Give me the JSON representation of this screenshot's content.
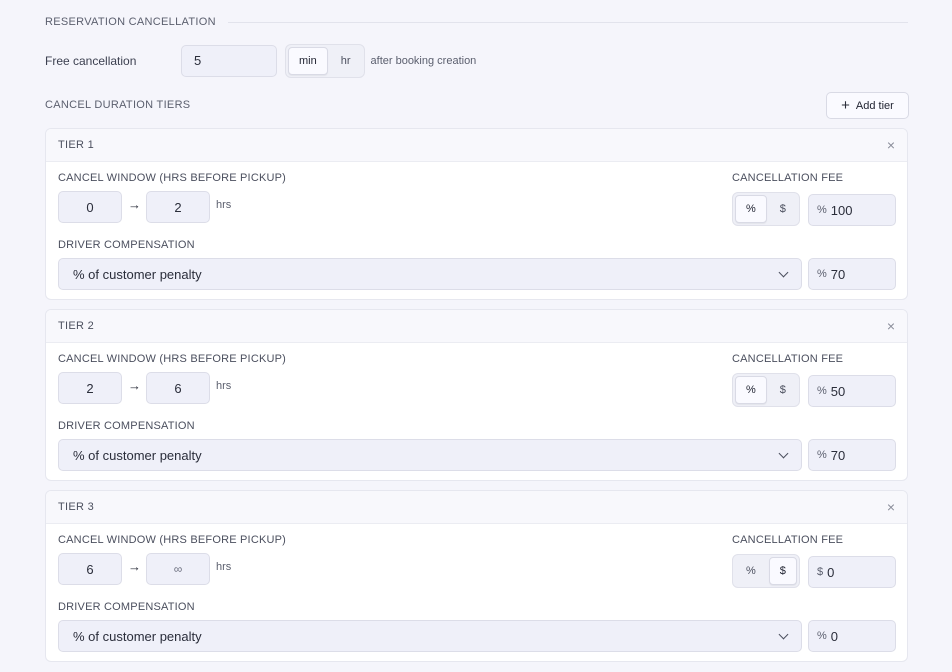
{
  "section": {
    "title": "RESERVATION CANCELLATION"
  },
  "free_cancellation": {
    "label": "Free cancellation",
    "value": "5",
    "units": [
      "min",
      "hr"
    ],
    "selected_unit": "min",
    "suffix": "after booking creation"
  },
  "tiers_section": {
    "title": "CANCEL DURATION TIERS",
    "add_label": "Add tier",
    "add_icon": "plus-icon"
  },
  "labels": {
    "window": "CANCEL WINDOW (HRS BEFORE PICKUP)",
    "fee": "CANCELLATION FEE",
    "compensation": "DRIVER COMPENSATION",
    "hrs": "hrs",
    "arrow": "→",
    "pct": "%",
    "usd": "$",
    "close": "×"
  },
  "tiers": [
    {
      "name": "TIER 1",
      "from": "0",
      "to": "2",
      "fee_type": "%",
      "fee_prefix": "%",
      "fee_value": "100",
      "comp_type": "% of customer penalty",
      "comp_prefix": "%",
      "comp_value": "70"
    },
    {
      "name": "TIER 2",
      "from": "2",
      "to": "6",
      "fee_type": "%",
      "fee_prefix": "%",
      "fee_value": "50",
      "comp_type": "% of customer penalty",
      "comp_prefix": "%",
      "comp_value": "70"
    },
    {
      "name": "TIER 3",
      "from": "6",
      "to": "∞",
      "fee_type": "$",
      "fee_prefix": "$",
      "fee_value": "0",
      "comp_type": "% of customer penalty",
      "comp_prefix": "%",
      "comp_value": "0"
    }
  ]
}
